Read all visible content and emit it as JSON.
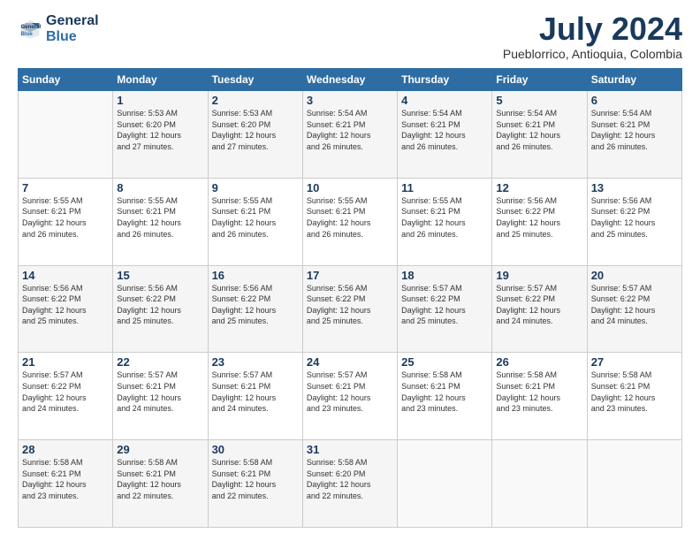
{
  "logo": {
    "line1": "General",
    "line2": "Blue"
  },
  "title": "July 2024",
  "subtitle": "Pueblorrico, Antioquia, Colombia",
  "weekdays": [
    "Sunday",
    "Monday",
    "Tuesday",
    "Wednesday",
    "Thursday",
    "Friday",
    "Saturday"
  ],
  "weeks": [
    [
      {
        "day": "",
        "info": ""
      },
      {
        "day": "1",
        "info": "Sunrise: 5:53 AM\nSunset: 6:20 PM\nDaylight: 12 hours\nand 27 minutes."
      },
      {
        "day": "2",
        "info": "Sunrise: 5:53 AM\nSunset: 6:20 PM\nDaylight: 12 hours\nand 27 minutes."
      },
      {
        "day": "3",
        "info": "Sunrise: 5:54 AM\nSunset: 6:21 PM\nDaylight: 12 hours\nand 26 minutes."
      },
      {
        "day": "4",
        "info": "Sunrise: 5:54 AM\nSunset: 6:21 PM\nDaylight: 12 hours\nand 26 minutes."
      },
      {
        "day": "5",
        "info": "Sunrise: 5:54 AM\nSunset: 6:21 PM\nDaylight: 12 hours\nand 26 minutes."
      },
      {
        "day": "6",
        "info": "Sunrise: 5:54 AM\nSunset: 6:21 PM\nDaylight: 12 hours\nand 26 minutes."
      }
    ],
    [
      {
        "day": "7",
        "info": "Sunrise: 5:55 AM\nSunset: 6:21 PM\nDaylight: 12 hours\nand 26 minutes."
      },
      {
        "day": "8",
        "info": "Sunrise: 5:55 AM\nSunset: 6:21 PM\nDaylight: 12 hours\nand 26 minutes."
      },
      {
        "day": "9",
        "info": "Sunrise: 5:55 AM\nSunset: 6:21 PM\nDaylight: 12 hours\nand 26 minutes."
      },
      {
        "day": "10",
        "info": "Sunrise: 5:55 AM\nSunset: 6:21 PM\nDaylight: 12 hours\nand 26 minutes."
      },
      {
        "day": "11",
        "info": "Sunrise: 5:55 AM\nSunset: 6:21 PM\nDaylight: 12 hours\nand 26 minutes."
      },
      {
        "day": "12",
        "info": "Sunrise: 5:56 AM\nSunset: 6:22 PM\nDaylight: 12 hours\nand 25 minutes."
      },
      {
        "day": "13",
        "info": "Sunrise: 5:56 AM\nSunset: 6:22 PM\nDaylight: 12 hours\nand 25 minutes."
      }
    ],
    [
      {
        "day": "14",
        "info": "Sunrise: 5:56 AM\nSunset: 6:22 PM\nDaylight: 12 hours\nand 25 minutes."
      },
      {
        "day": "15",
        "info": "Sunrise: 5:56 AM\nSunset: 6:22 PM\nDaylight: 12 hours\nand 25 minutes."
      },
      {
        "day": "16",
        "info": "Sunrise: 5:56 AM\nSunset: 6:22 PM\nDaylight: 12 hours\nand 25 minutes."
      },
      {
        "day": "17",
        "info": "Sunrise: 5:56 AM\nSunset: 6:22 PM\nDaylight: 12 hours\nand 25 minutes."
      },
      {
        "day": "18",
        "info": "Sunrise: 5:57 AM\nSunset: 6:22 PM\nDaylight: 12 hours\nand 25 minutes."
      },
      {
        "day": "19",
        "info": "Sunrise: 5:57 AM\nSunset: 6:22 PM\nDaylight: 12 hours\nand 24 minutes."
      },
      {
        "day": "20",
        "info": "Sunrise: 5:57 AM\nSunset: 6:22 PM\nDaylight: 12 hours\nand 24 minutes."
      }
    ],
    [
      {
        "day": "21",
        "info": "Sunrise: 5:57 AM\nSunset: 6:22 PM\nDaylight: 12 hours\nand 24 minutes."
      },
      {
        "day": "22",
        "info": "Sunrise: 5:57 AM\nSunset: 6:21 PM\nDaylight: 12 hours\nand 24 minutes."
      },
      {
        "day": "23",
        "info": "Sunrise: 5:57 AM\nSunset: 6:21 PM\nDaylight: 12 hours\nand 24 minutes."
      },
      {
        "day": "24",
        "info": "Sunrise: 5:57 AM\nSunset: 6:21 PM\nDaylight: 12 hours\nand 23 minutes."
      },
      {
        "day": "25",
        "info": "Sunrise: 5:58 AM\nSunset: 6:21 PM\nDaylight: 12 hours\nand 23 minutes."
      },
      {
        "day": "26",
        "info": "Sunrise: 5:58 AM\nSunset: 6:21 PM\nDaylight: 12 hours\nand 23 minutes."
      },
      {
        "day": "27",
        "info": "Sunrise: 5:58 AM\nSunset: 6:21 PM\nDaylight: 12 hours\nand 23 minutes."
      }
    ],
    [
      {
        "day": "28",
        "info": "Sunrise: 5:58 AM\nSunset: 6:21 PM\nDaylight: 12 hours\nand 23 minutes."
      },
      {
        "day": "29",
        "info": "Sunrise: 5:58 AM\nSunset: 6:21 PM\nDaylight: 12 hours\nand 22 minutes."
      },
      {
        "day": "30",
        "info": "Sunrise: 5:58 AM\nSunset: 6:21 PM\nDaylight: 12 hours\nand 22 minutes."
      },
      {
        "day": "31",
        "info": "Sunrise: 5:58 AM\nSunset: 6:20 PM\nDaylight: 12 hours\nand 22 minutes."
      },
      {
        "day": "",
        "info": ""
      },
      {
        "day": "",
        "info": ""
      },
      {
        "day": "",
        "info": ""
      }
    ]
  ]
}
